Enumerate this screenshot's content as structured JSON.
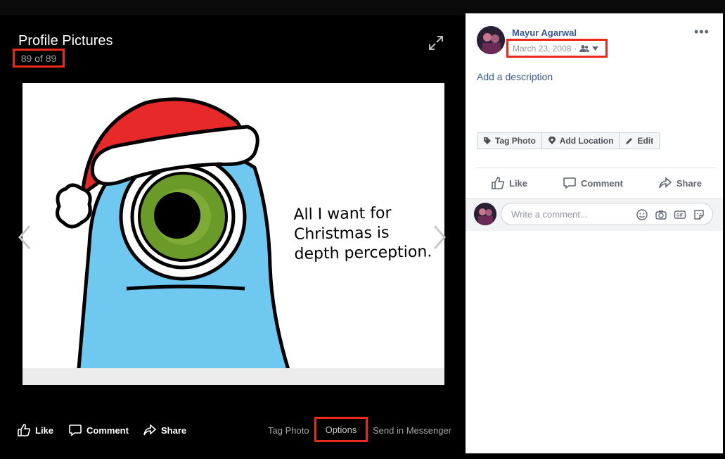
{
  "viewer": {
    "album_title": "Profile Pictures",
    "counter": "89 of 89",
    "photo_caption_lines": [
      "All I want for",
      "Christmas is",
      "depth perception."
    ],
    "actions": {
      "like": "Like",
      "comment": "Comment",
      "share": "Share",
      "tag_photo": "Tag Photo",
      "options": "Options",
      "send_in_messenger": "Send in Messenger"
    }
  },
  "sidebar": {
    "user_name": "Mayur Agarwal",
    "date": "March 23, 2008",
    "date_separator": "·",
    "add_description": "Add a description",
    "tag_toolbar": {
      "tag_photo": "Tag Photo",
      "add_location": "Add Location",
      "edit": "Edit"
    },
    "actions": {
      "like": "Like",
      "comment": "Comment",
      "share": "Share"
    },
    "comment_placeholder": "Write a comment..."
  },
  "colors": {
    "highlight": "#e8291c",
    "link": "#385898",
    "eye_green": "#6a9a28",
    "monster_blue": "#6fc8f0",
    "hat_red": "#e8292a"
  }
}
